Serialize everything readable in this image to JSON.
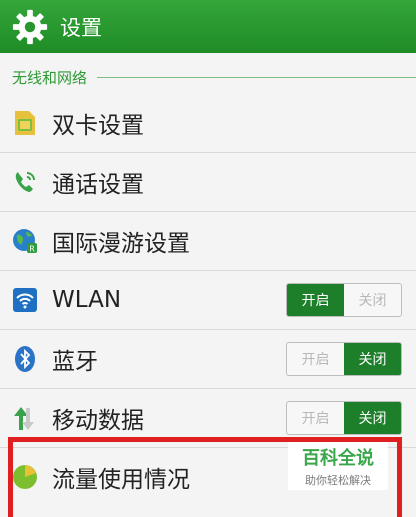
{
  "header": {
    "title": "设置",
    "icon": "gear-icon"
  },
  "section": {
    "label": "无线和网络"
  },
  "rows": [
    {
      "label": "双卡设置",
      "icon": "sim-card-icon"
    },
    {
      "label": "通话设置",
      "icon": "phone-call-icon"
    },
    {
      "label": "国际漫游设置",
      "icon": "globe-roaming-icon"
    },
    {
      "label": "WLAN",
      "icon": "wifi-icon",
      "toggle": {
        "on_label": "开启",
        "off_label": "关闭",
        "state": "on"
      }
    },
    {
      "label": "蓝牙",
      "icon": "bluetooth-icon",
      "toggle": {
        "on_label": "开启",
        "off_label": "关闭",
        "state": "off"
      }
    },
    {
      "label": "移动数据",
      "icon": "data-arrows-icon",
      "toggle": {
        "on_label": "开启",
        "off_label": "关闭",
        "state": "off"
      }
    },
    {
      "label": "流量使用情况",
      "icon": "pie-chart-icon"
    }
  ],
  "watermark": {
    "title": "百科全说",
    "subtitle": "助你轻松解决"
  },
  "colors": {
    "accent": "#2e9a35",
    "toggle_active": "#1e7f2a",
    "highlight": "#e02020"
  }
}
